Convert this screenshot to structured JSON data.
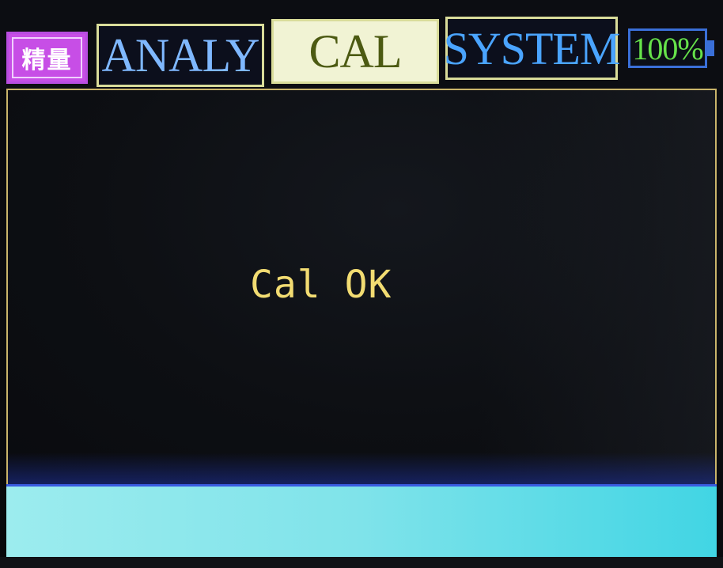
{
  "topbar": {
    "logo_text": "精量",
    "tabs": [
      {
        "label": "ANALY",
        "active": false
      },
      {
        "label": "CAL",
        "active": true
      },
      {
        "label": "SYSTEM",
        "active": false
      }
    ],
    "battery": "100%"
  },
  "main": {
    "message": "Cal OK"
  },
  "status": {
    "text": ""
  },
  "colors": {
    "tab_border": "#d9dc9a",
    "active_tab_bg": "#f1f3d4",
    "message_text": "#f2dc72",
    "statusbar": "#7fe3ea",
    "battery_text": "#66e24a",
    "logo_bg": "#c74ee6"
  }
}
